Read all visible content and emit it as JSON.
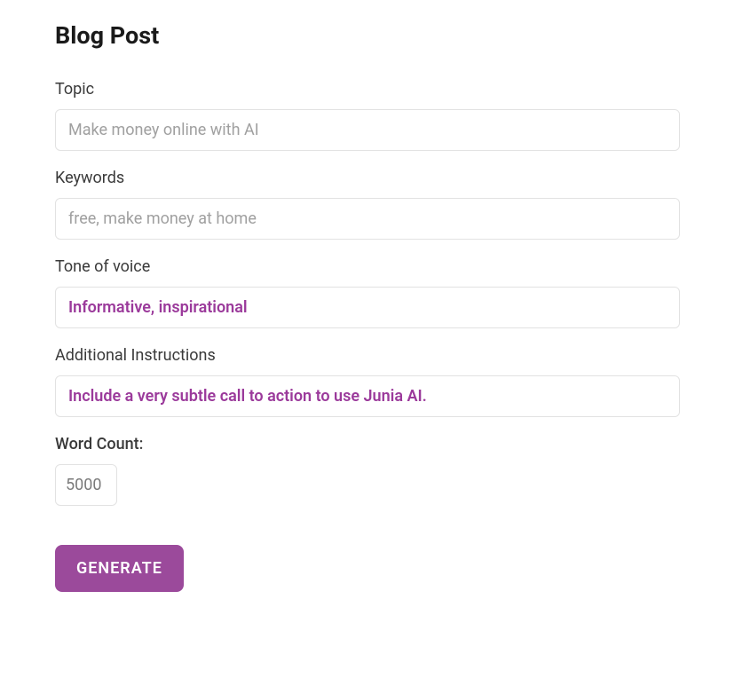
{
  "title": "Blog Post",
  "form": {
    "topic": {
      "label": "Topic",
      "placeholder": "Make money online with AI",
      "value": ""
    },
    "keywords": {
      "label": "Keywords",
      "placeholder": "free, make money at home",
      "value": ""
    },
    "tone": {
      "label": "Tone of voice",
      "value": "Informative, inspirational"
    },
    "instructions": {
      "label": "Additional Instructions",
      "value": "Include a very subtle call to action to use Junia AI."
    },
    "word_count": {
      "label": "Word Count:",
      "value": "5000"
    },
    "generate_label": "GENERATE"
  }
}
